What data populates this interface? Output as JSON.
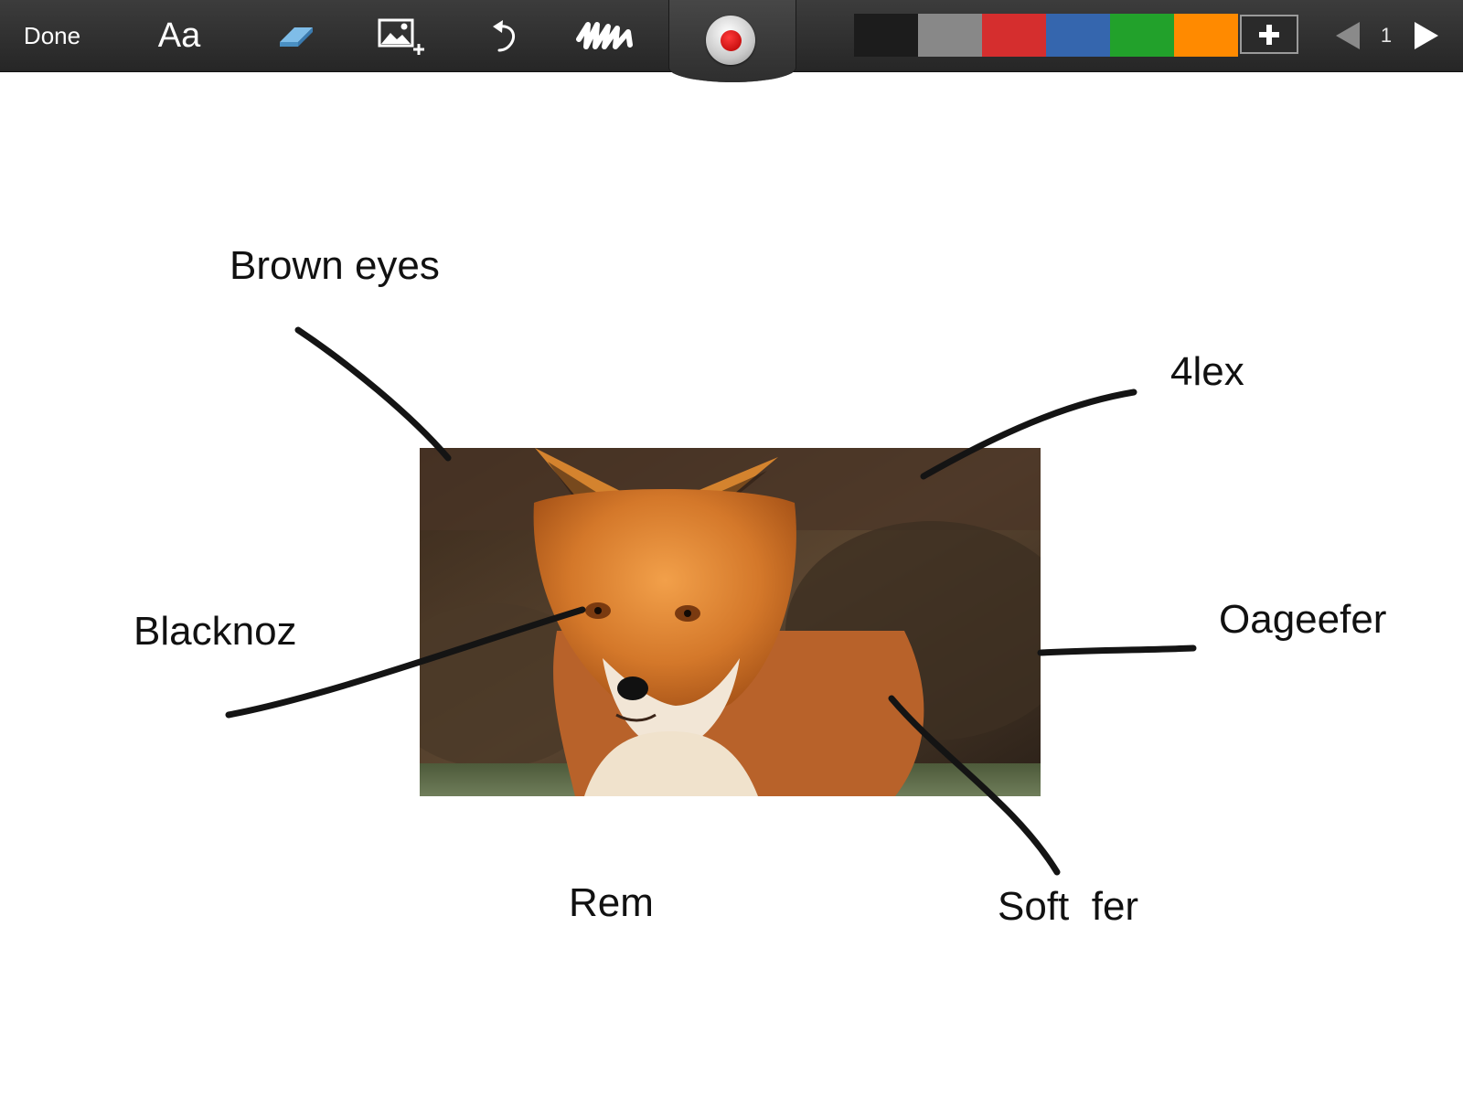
{
  "toolbar": {
    "done_label": "Done",
    "font_label": "Aa",
    "tools": [
      {
        "name": "text-tool",
        "icon": "text-icon"
      },
      {
        "name": "eraser-tool",
        "icon": "eraser-icon"
      },
      {
        "name": "insert-image-tool",
        "icon": "image-add-icon"
      },
      {
        "name": "undo-tool",
        "icon": "undo-icon"
      },
      {
        "name": "clear-tool",
        "icon": "scribble-clear-icon"
      },
      {
        "name": "record-button",
        "icon": "record-icon"
      }
    ],
    "colors": [
      {
        "name": "black",
        "hex": "#1c1c1c"
      },
      {
        "name": "gray",
        "hex": "#888888"
      },
      {
        "name": "red",
        "hex": "#d52e2e"
      },
      {
        "name": "blue",
        "hex": "#3566ae"
      },
      {
        "name": "green",
        "hex": "#22a12b"
      },
      {
        "name": "orange",
        "hex": "#ff8a00"
      }
    ],
    "add_color_icon": "plus-icon",
    "page_number": "1",
    "prev_icon": "prev-page-icon",
    "next_icon": "next-page-icon"
  },
  "canvas": {
    "image_subject": "fox",
    "labels": {
      "brown_eyes": "Brown eyes",
      "four_lex": "4lex",
      "blacknoz": "Blacknoz",
      "oageefer": "Oageefer",
      "rem": "Rem",
      "soft_fer": "Soft  fer"
    }
  }
}
